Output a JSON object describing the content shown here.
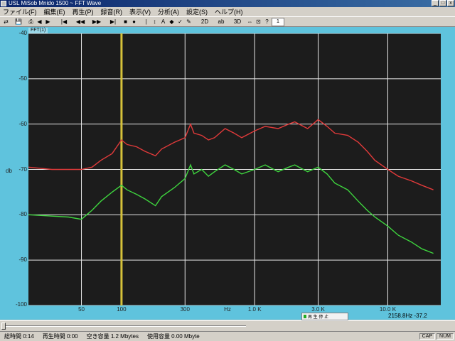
{
  "window": {
    "title": "USL MiSob Mnido 1500 ~ FFT Wave"
  },
  "menu": [
    "ファイル(F)",
    "編集(E)",
    "再生(P)",
    "録音(R)",
    "表示(V)",
    "分析(A)",
    "設定(S)",
    "ヘルプ(H)"
  ],
  "toolbar": {
    "buttons": [
      "⇄",
      "💾",
      "⎙",
      "◀",
      "▶",
      "|◀",
      "◀◀",
      "▶▶",
      "▶|",
      "■",
      "●",
      "|",
      "↕",
      "A",
      "◆",
      "✓",
      "✎",
      "2D",
      "ab",
      "3D",
      "⇔",
      "⊡",
      "?"
    ],
    "zoom_value": "1"
  },
  "document": {
    "tab_label": "FFT(1)"
  },
  "chart_data": {
    "type": "line",
    "xscale": "log",
    "xlim": [
      20,
      25000
    ],
    "ylim": [
      -100,
      -40
    ],
    "ylabel": "db",
    "xlabel": "Hz",
    "x_ticks": [
      "50",
      "100",
      "300",
      "1.0 K",
      "3.0 K",
      "10.0 K"
    ],
    "y_ticks": [
      "-40",
      "-50",
      "-60",
      "-70",
      "-80",
      "-90",
      "-100"
    ],
    "grid": true,
    "cursor_x": 100,
    "series": [
      {
        "color": "#e03a3a",
        "x": [
          20,
          30,
          40,
          50,
          60,
          70,
          85,
          100,
          110,
          130,
          150,
          180,
          200,
          250,
          300,
          330,
          350,
          400,
          450,
          500,
          600,
          700,
          800,
          1000,
          1200,
          1500,
          1800,
          2000,
          2500,
          3000,
          3500,
          4000,
          5000,
          6000,
          7000,
          8000,
          10000,
          12000,
          15000,
          18000,
          22000
        ],
        "values": [
          -69.5,
          -70,
          -70,
          -70,
          -69.5,
          -68,
          -66.5,
          -63.5,
          -64.5,
          -65,
          -66,
          -67,
          -65.5,
          -64,
          -63,
          -60,
          -62,
          -62.5,
          -63.5,
          -63,
          -61,
          -62,
          -63,
          -61.5,
          -60.5,
          -61,
          -60,
          -59.5,
          -61,
          -59,
          -60.5,
          -62,
          -62.5,
          -64,
          -66,
          -68,
          -70,
          -71.5,
          -72.5,
          -73.5,
          -74.5
        ]
      },
      {
        "color": "#3ed43e",
        "x": [
          20,
          30,
          40,
          50,
          60,
          70,
          85,
          100,
          110,
          130,
          150,
          180,
          200,
          250,
          300,
          330,
          350,
          400,
          450,
          500,
          600,
          700,
          800,
          1000,
          1200,
          1500,
          1800,
          2000,
          2500,
          3000,
          3500,
          4000,
          5000,
          6000,
          7000,
          8000,
          10000,
          12000,
          15000,
          18000,
          22000
        ],
        "values": [
          -80,
          -80.3,
          -80.5,
          -81,
          -79,
          -77,
          -75,
          -73.5,
          -74.5,
          -75.5,
          -76.5,
          -78,
          -76,
          -74,
          -72,
          -69,
          -71,
          -70,
          -71.5,
          -70.5,
          -69,
          -70,
          -71,
          -70,
          -69,
          -70.5,
          -69.5,
          -69,
          -70.5,
          -69.5,
          -71,
          -73,
          -74.5,
          -77,
          -79,
          -80.5,
          -82.5,
          -84.5,
          -86,
          -87.5,
          -88.5
        ]
      }
    ]
  },
  "readout": "2158.8Hz -37.2",
  "playback_controls": {
    "label": "再 生 停 止"
  },
  "status": {
    "total_time": "総時間 0:14",
    "play_time": "再生時間 0:00",
    "free_space": "空き容量 1.2 Mbytes",
    "used_space": "使用容量 0.00 Mbyte",
    "caps": "CAP",
    "num": "NUM"
  }
}
